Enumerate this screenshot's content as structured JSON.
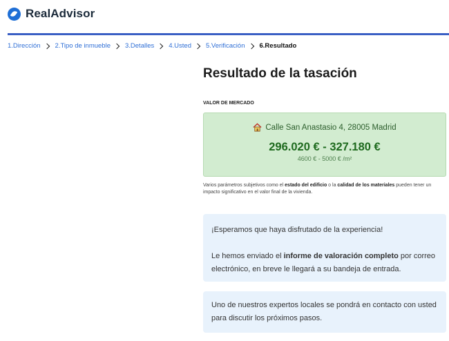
{
  "brand": {
    "name": "RealAdvisor"
  },
  "breadcrumb": {
    "steps": [
      "1.Dirección",
      "2.Tipo de inmueble",
      "3.Detalles",
      "4.Usted",
      "5.Verificación",
      "6.Resultado"
    ]
  },
  "result": {
    "title": "Resultado de la tasación",
    "section_label": "VALOR DE MERCADO",
    "address": "Calle San Anastasio 4, 28005 Madrid",
    "price_range": "296.020 € - 327.180 €",
    "price_per_m2": "4600 € - 5000 € /m²",
    "note": {
      "part1": "Varios parámetros subjetivos como el ",
      "bold1": "estado del edificio",
      "part2": " o la ",
      "bold2": "calidad de los materiales",
      "part3": " pueden tener un impacto significativo en el valor final de la vivienda."
    }
  },
  "messages": {
    "thanks": "¡Esperamos que haya disfrutado de la experiencia!",
    "report_part1": "Le hemos enviado el ",
    "report_bold": "informe de valoración completo",
    "report_part2": " por correo electrónico, en breve le llegará a su bandeja de entrada.",
    "expert": "Uno de nuestros expertos locales se pondrá en contacto con usted para discutir los próximos pasos."
  },
  "colors": {
    "brand_blue": "#1f6fd6",
    "valuation_bg": "#d2ecd0",
    "price_green": "#1e6a1e",
    "info_bg": "#e8f2fc"
  }
}
